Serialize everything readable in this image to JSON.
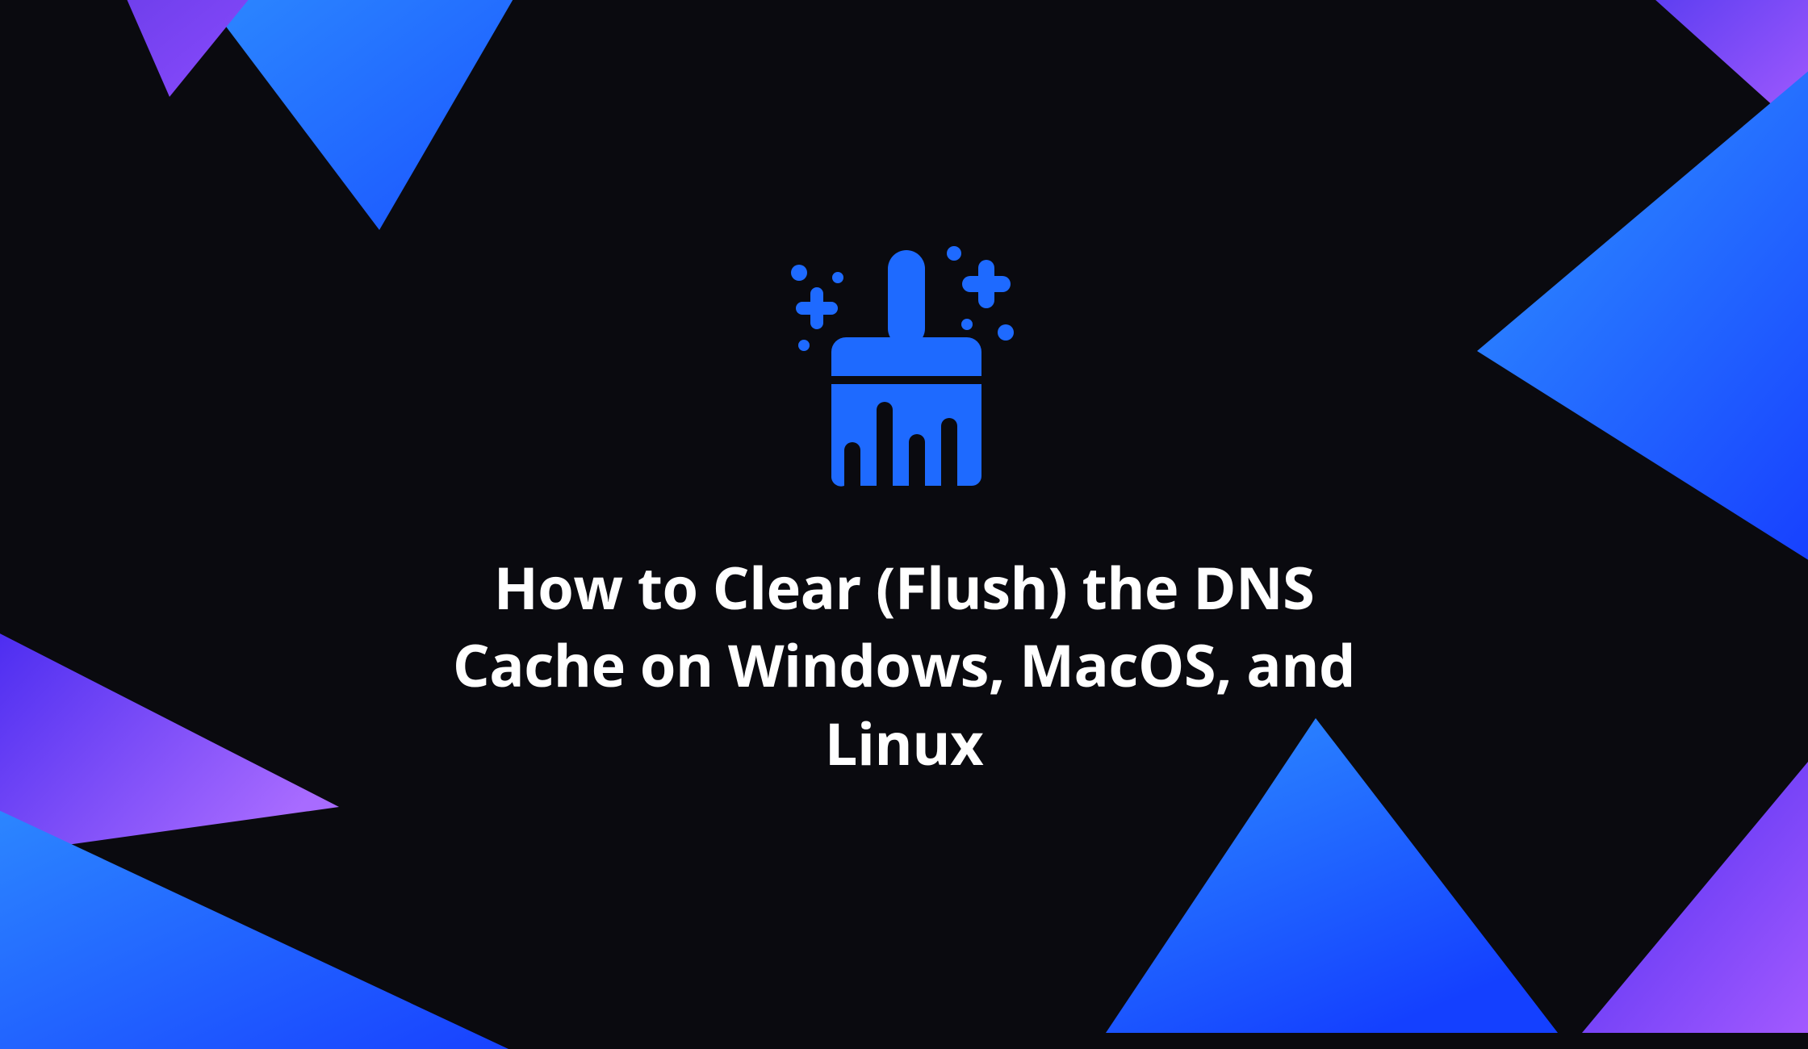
{
  "hero": {
    "title": "How to Clear (Flush) the DNS Cache on Windows, MacOS, and Linux",
    "icon": "sparkle-brush-icon"
  },
  "colors": {
    "background": "#0a0a0f",
    "accent_blue": "#1e6aff",
    "accent_blue_light": "#2c87ff",
    "gradient_start": "#3a2cf0",
    "gradient_end": "#9b4bff",
    "text": "#ffffff"
  }
}
